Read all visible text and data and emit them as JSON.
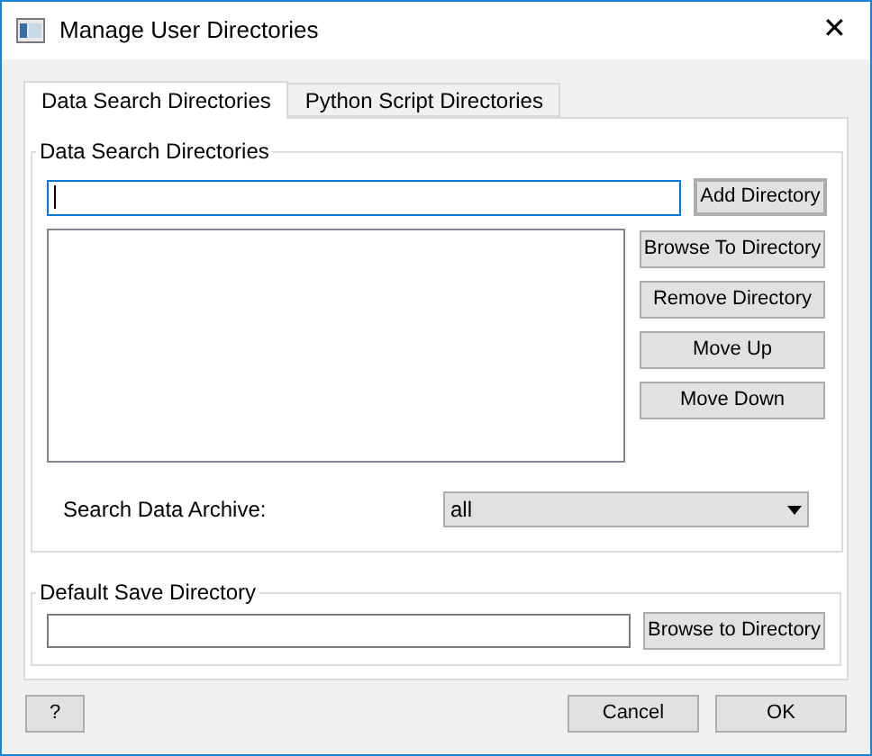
{
  "window": {
    "title": "Manage User Directories",
    "close": "✕"
  },
  "tabs": [
    {
      "label": "Data Search Directories",
      "selected": true
    },
    {
      "label": "Python Script Directories",
      "selected": false
    }
  ],
  "data_search": {
    "title": "Data Search Directories",
    "path_field": {
      "focused": true
    },
    "add_button": {
      "label": "Add Directory",
      "default": true
    },
    "buttons": [
      "Browse To Directory",
      "Remove Directory",
      "Move Up",
      "Move Down"
    ],
    "archive": {
      "label": "Search Data Archive:",
      "value": "all"
    }
  },
  "default_save": {
    "title": "Default Save Directory",
    "button": "Browse to Directory"
  },
  "footer": {
    "help": "?",
    "buttons": [
      "Cancel",
      "OK"
    ]
  }
}
